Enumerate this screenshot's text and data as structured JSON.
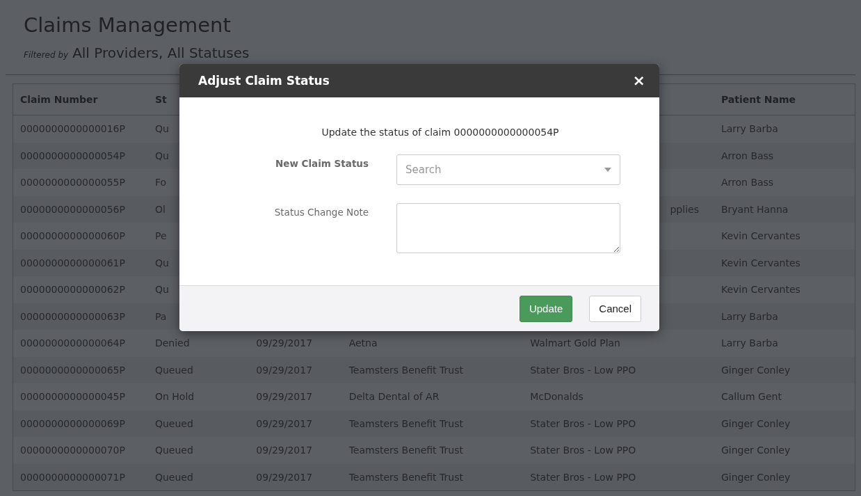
{
  "page": {
    "title": "Claims Management",
    "filter_label": "Filtered by",
    "filter_value": "All Providers, All Statuses"
  },
  "table": {
    "columns": [
      "Claim Number",
      "St",
      null,
      null,
      null,
      "Patient Name"
    ],
    "rows": [
      {
        "cells": [
          "0000000000000016P",
          "Qu",
          null,
          null,
          null,
          "Larry Barba"
        ]
      },
      {
        "cells": [
          "0000000000000054P",
          "Qu",
          null,
          null,
          null,
          "Arron Bass"
        ]
      },
      {
        "cells": [
          "0000000000000055P",
          "Fo",
          null,
          null,
          null,
          "Arron Bass"
        ]
      },
      {
        "cells": [
          "0000000000000056P",
          "Ol",
          null,
          null,
          "pplies",
          "Bryant Hanna"
        ]
      },
      {
        "cells": [
          "0000000000000060P",
          "Pe",
          null,
          null,
          null,
          "Kevin Cervantes"
        ]
      },
      {
        "cells": [
          "0000000000000061P",
          "Qu",
          null,
          null,
          null,
          "Kevin Cervantes"
        ]
      },
      {
        "cells": [
          "0000000000000062P",
          "Qu",
          null,
          null,
          null,
          "Kevin Cervantes"
        ]
      },
      {
        "cells": [
          "0000000000000063P",
          "Pa",
          null,
          null,
          null,
          "Larry Barba"
        ]
      },
      {
        "cells": [
          "0000000000000064P",
          "Denied",
          "09/29/2017",
          "Aetna",
          "Walmart Gold Plan",
          "Larry Barba"
        ]
      },
      {
        "cells": [
          "0000000000000065P",
          "Queued",
          "09/29/2017",
          "Teamsters Benefit Trust",
          "Stater Bros - Low PPO",
          "Ginger Conley"
        ]
      },
      {
        "cells": [
          "0000000000000045P",
          "On Hold",
          "09/29/2017",
          "Delta Dental of AR",
          "McDonalds",
          "Callum Gent"
        ]
      },
      {
        "cells": [
          "0000000000000069P",
          "Queued",
          "09/29/2017",
          "Teamsters Benefit Trust",
          "Stater Bros - Low PPO",
          "Ginger Conley"
        ]
      },
      {
        "cells": [
          "0000000000000070P",
          "Queued",
          "09/29/2017",
          "Teamsters Benefit Trust",
          "Stater Bros - Low PPO",
          "Ginger Conley"
        ]
      },
      {
        "cells": [
          "0000000000000071P",
          "Queued",
          "09/29/2017",
          "Teamsters Benefit Trust",
          "Stater Bros - Low PPO",
          "Ginger Conley"
        ]
      }
    ]
  },
  "dialog": {
    "title": "Adjust Claim Status",
    "close": "×",
    "message": "Update the status of claim 0000000000000054P",
    "fields": [
      {
        "kind": "select",
        "label": "New Claim Status",
        "required": true,
        "placeholder": "Search"
      },
      {
        "kind": "textarea",
        "label": "Status Change Note",
        "required": false
      }
    ],
    "buttons": [
      {
        "kind": "primary",
        "label": "Update"
      },
      {
        "kind": "default",
        "label": "Cancel"
      }
    ]
  }
}
